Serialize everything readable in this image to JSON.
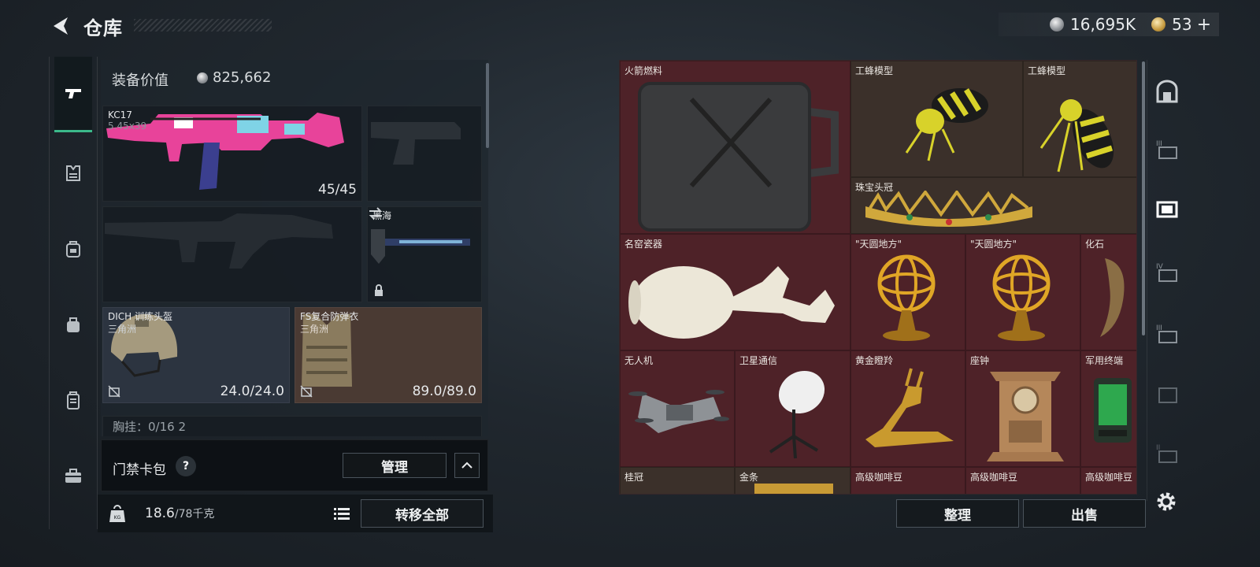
{
  "header": {
    "title": "仓库",
    "currency_silver": "16,695K",
    "currency_gold": "53",
    "currency_gold_plus": "+"
  },
  "loadout": {
    "equip_value_label": "装备价值",
    "equip_value": "825,662",
    "primary_weapon": {
      "name": "KC17",
      "caliber": "5.45x39",
      "ammo": "45/45"
    },
    "melee": {
      "name": "黑海"
    },
    "helmet": {
      "name": "DICH 训练头盔",
      "origin": "三角洲",
      "durability": "24.0/24.0"
    },
    "armor": {
      "name": "FS复合防弹衣",
      "origin": "三角洲",
      "durability": "89.0/89.0"
    },
    "chest_rig": {
      "label": "胸挂：0/16  2"
    }
  },
  "card_bar": {
    "label": "门禁卡包",
    "help": "?",
    "manage": "管理"
  },
  "weight": {
    "current": "18.6",
    "max": "/78千克"
  },
  "actions": {
    "transfer_all": "转移全部",
    "sort": "整理",
    "sell": "出售"
  },
  "stash_items": [
    {
      "name": "火箭燃料"
    },
    {
      "name": "工蜂模型"
    },
    {
      "name": "工蜂模型"
    },
    {
      "name": "珠宝头冠"
    },
    {
      "name": "名窑瓷器"
    },
    {
      "name": "\"天圆地方\""
    },
    {
      "name": "\"天圆地方\""
    },
    {
      "name": "化石"
    },
    {
      "name": "无人机"
    },
    {
      "name": "卫星通信"
    },
    {
      "name": "黄金瞪羚"
    },
    {
      "name": "座钟"
    },
    {
      "name": "军用终端"
    },
    {
      "name": "桂冠"
    },
    {
      "name": "金条"
    },
    {
      "name": "高级咖啡豆"
    },
    {
      "name": "高级咖啡豆"
    },
    {
      "name": "高级咖啡豆"
    }
  ],
  "colors": {
    "accent": "#3bb98a",
    "stash_red": "#4e2228",
    "stash_brown": "#3b302a"
  }
}
